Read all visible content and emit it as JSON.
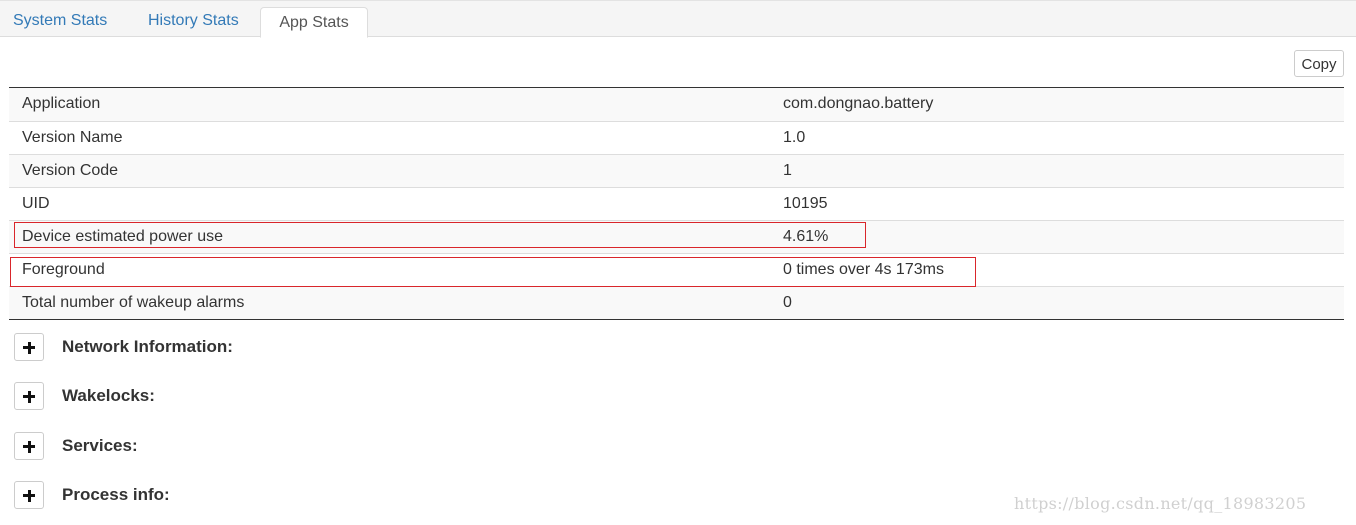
{
  "tabs": [
    {
      "label": "System Stats",
      "active": false
    },
    {
      "label": "History Stats",
      "active": false
    },
    {
      "label": "App Stats",
      "active": true
    }
  ],
  "toolbar": {
    "copy_label": "Copy"
  },
  "table": {
    "rows": [
      {
        "key": "Application",
        "value": "com.dongnao.battery"
      },
      {
        "key": "Version Name",
        "value": "1.0"
      },
      {
        "key": "Version Code",
        "value": "1"
      },
      {
        "key": "UID",
        "value": "10195"
      },
      {
        "key": "Device estimated power use",
        "value": "4.61%"
      },
      {
        "key": "Foreground",
        "value": "0 times over 4s 173ms"
      },
      {
        "key": "Total number of wakeup alarms",
        "value": "0"
      }
    ]
  },
  "sections": [
    {
      "title": "Network Information:"
    },
    {
      "title": "Wakelocks:"
    },
    {
      "title": "Services:"
    },
    {
      "title": "Process info:"
    }
  ],
  "watermark": "https://blog.csdn.net/qq_18983205",
  "colors": {
    "link": "#337ab7",
    "highlight": "#d9262b",
    "row_stripe": "#f9f9f9"
  }
}
